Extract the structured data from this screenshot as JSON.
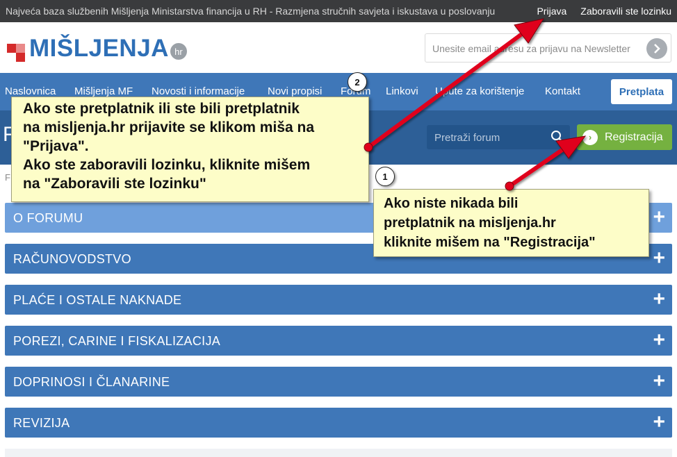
{
  "topbar": {
    "tagline": "Najveća baza službenih Mišljenja Ministarstva financija u RH - Razmjena stručnih savjeta i iskustava u poslovanju",
    "login": "Prijava",
    "forgot": "Zaboravili ste lozinku"
  },
  "header": {
    "logo_text": "MIŠLJENJA",
    "logo_tld": "hr",
    "newsletter_placeholder": "Unesite email adresu za prijavu na Newsletter"
  },
  "nav": {
    "items": [
      "Naslovnica",
      "Mišljenja MF",
      "Novosti i informacije",
      "Novi propisi",
      "Forum",
      "Linkovi",
      "Upute za korištenje",
      "Kontakt"
    ],
    "pretplata": "Pretplata"
  },
  "band": {
    "big_letter": "F",
    "search_placeholder": "Pretraži forum",
    "register": "Registracija"
  },
  "breadcrumb": "F",
  "accordion": [
    {
      "label": "O FORUMU"
    },
    {
      "label": "RAČUNOVODSTVO"
    },
    {
      "label": "PLAĆE I OSTALE NAKNADE"
    },
    {
      "label": "POREZI, CARINE I FISKALIZACIJA"
    },
    {
      "label": "DOPRINOSI I ČLANARINE"
    },
    {
      "label": "REVIZIJA"
    }
  ],
  "callouts": {
    "login": [
      "Ako ste pretplatnik ili ste bili pretplatnik",
      "na misljenja.hr prijavite se klikom miša na",
      "\"Prijava\".",
      "Ako ste zaboravili lozinku, kliknite mišem",
      "na \"Zaboravili ste lozinku\""
    ],
    "register": [
      "Ako niste nikada bili",
      "pretplatnik na misljenja.hr",
      "kliknite mišem na \"Registracija\""
    ]
  },
  "markers": {
    "one": "1",
    "two": "2"
  },
  "colors": {
    "topbar": "#3a3b3d",
    "nav": "#3f77b8",
    "band": "#2d5f97",
    "register": "#75b140",
    "callout": "#fdfdc8",
    "arrow": "#e0001a"
  }
}
